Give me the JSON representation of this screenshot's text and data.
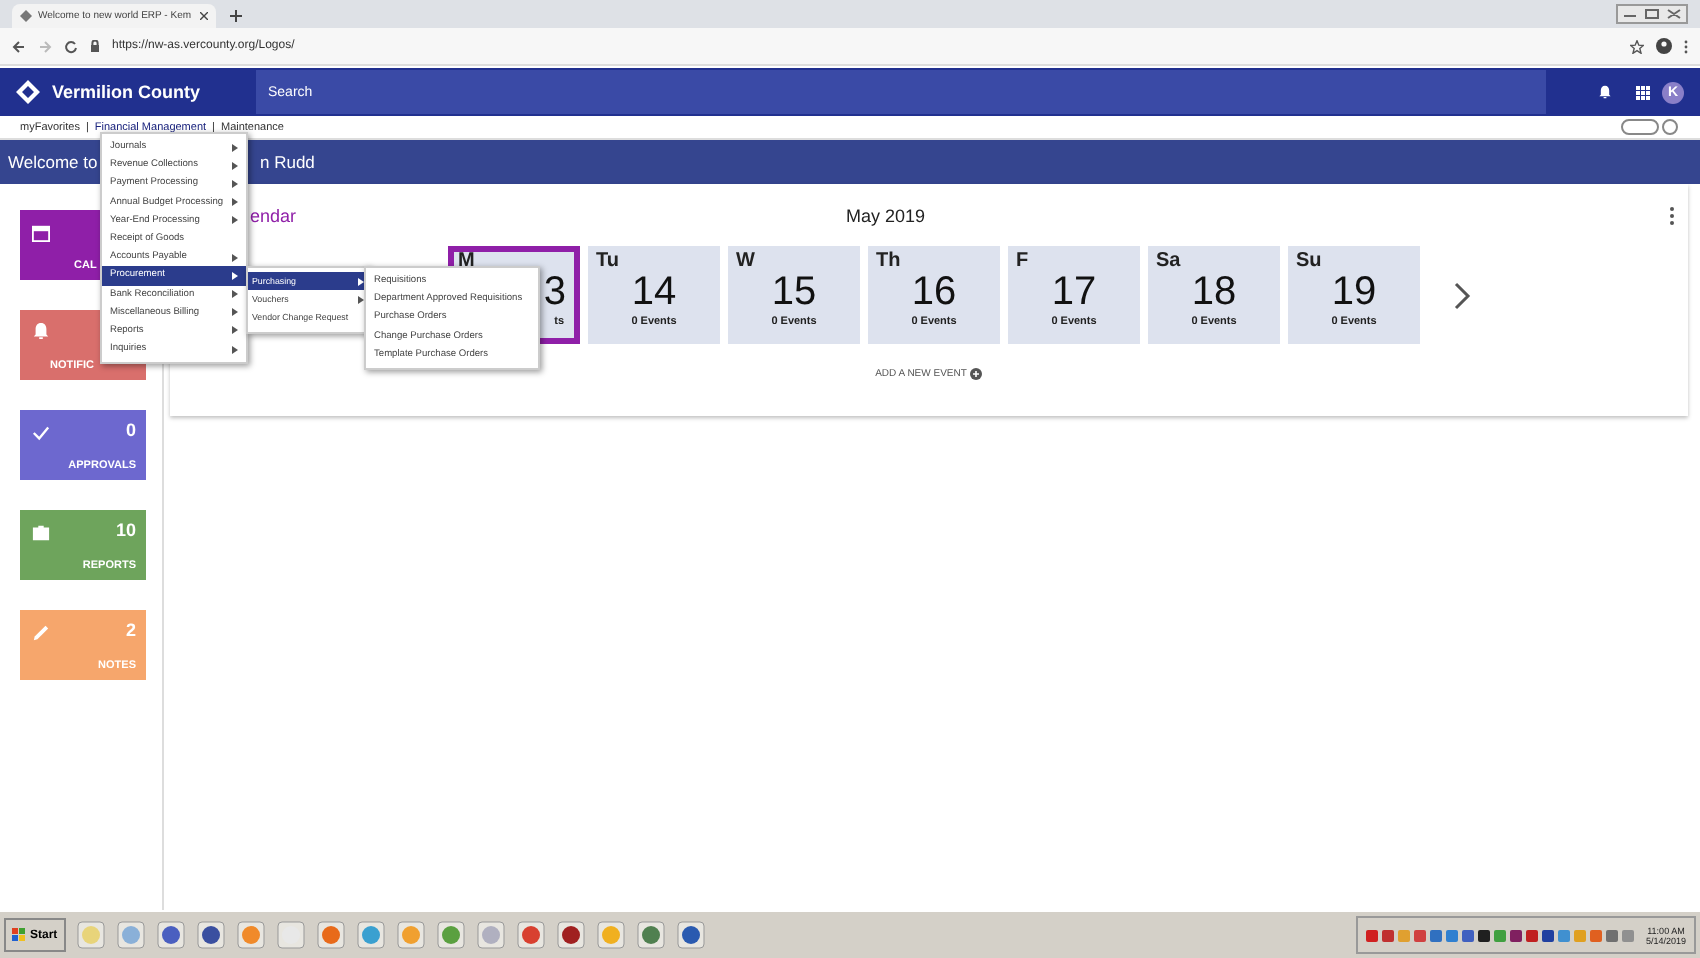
{
  "browser": {
    "tab_title": "Welcome to new world ERP - Kem",
    "url": "https://nw-as.vercounty.org/Logos/",
    "avatar": "K"
  },
  "header": {
    "brand": "Vermilion County",
    "search": {
      "placeholder": "Search"
    }
  },
  "menu_bar_separator": "|",
  "menu_bar": [
    {
      "label": "myFavorites",
      "selected": false
    },
    {
      "label": "Financial Management",
      "selected": true
    },
    {
      "label": "Maintenance",
      "selected": false
    }
  ],
  "banner": {
    "text_start": "Welcome to",
    "text_end": "n Rudd"
  },
  "tiles": [
    {
      "kind": "calendar",
      "label": "CAL",
      "color": "#8f1fa8"
    },
    {
      "kind": "bell",
      "label": "NOTIFIC",
      "color": "#d96f6c"
    },
    {
      "kind": "check",
      "label": "APPROVALS",
      "count": "0",
      "color": "#6d68cf"
    },
    {
      "kind": "briefcase",
      "label": "REPORTS",
      "count": "10",
      "color": "#6ea45c"
    },
    {
      "kind": "pencil",
      "label": "NOTES",
      "count": "2",
      "color": "#f6a66c"
    }
  ],
  "calendar": {
    "heading": "endar",
    "month": "May 2019",
    "add_event": "ADD A NEW EVENT",
    "days": [
      {
        "label": "M",
        "number": "3",
        "events": "ts",
        "selected": true
      },
      {
        "label": "Tu",
        "number": "14",
        "events": "0 Events",
        "selected": false
      },
      {
        "label": "W",
        "number": "15",
        "events": "0 Events",
        "selected": false
      },
      {
        "label": "Th",
        "number": "16",
        "events": "0 Events",
        "selected": false
      },
      {
        "label": "F",
        "number": "17",
        "events": "0 Events",
        "selected": false
      },
      {
        "label": "Sa",
        "number": "18",
        "events": "0 Events",
        "selected": false
      },
      {
        "label": "Su",
        "number": "19",
        "events": "0 Events",
        "selected": false
      }
    ]
  },
  "menu": [
    {
      "label": "Journals",
      "submenu": true,
      "selected": false
    },
    {
      "label": "Revenue Collections",
      "submenu": true,
      "selected": false
    },
    {
      "label": "Payment Processing",
      "submenu": true,
      "selected": false
    },
    {
      "label": "Annual Budget Processing",
      "submenu": true,
      "selected": false
    },
    {
      "label": "Year-End Processing",
      "submenu": true,
      "selected": false
    },
    {
      "label": "Receipt of Goods",
      "submenu": false,
      "selected": false
    },
    {
      "label": "Accounts Payable",
      "submenu": true,
      "selected": false
    },
    {
      "label": "Procurement",
      "submenu": true,
      "selected": true
    },
    {
      "label": "Bank Reconciliation",
      "submenu": true,
      "selected": false
    },
    {
      "label": "Miscellaneous Billing",
      "submenu": true,
      "selected": false
    },
    {
      "label": "Reports",
      "submenu": true,
      "selected": false
    },
    {
      "label": "Inquiries",
      "submenu": true,
      "selected": false
    }
  ],
  "submenu": [
    {
      "label": "Purchasing",
      "submenu": true,
      "selected": true
    },
    {
      "label": "Vouchers",
      "submenu": true,
      "selected": false
    },
    {
      "label": "Vendor Change Request",
      "submenu": false,
      "selected": false
    }
  ],
  "subsubmenu": [
    {
      "label": "Requisitions"
    },
    {
      "label": "Department Approved Requisitions"
    },
    {
      "label": "Purchase Orders"
    },
    {
      "label": "Change Purchase Orders"
    },
    {
      "label": "Template Purchase Orders"
    }
  ],
  "taskbar": {
    "start": "Start",
    "time": "11:00 AM",
    "date": "5/14/2019"
  }
}
